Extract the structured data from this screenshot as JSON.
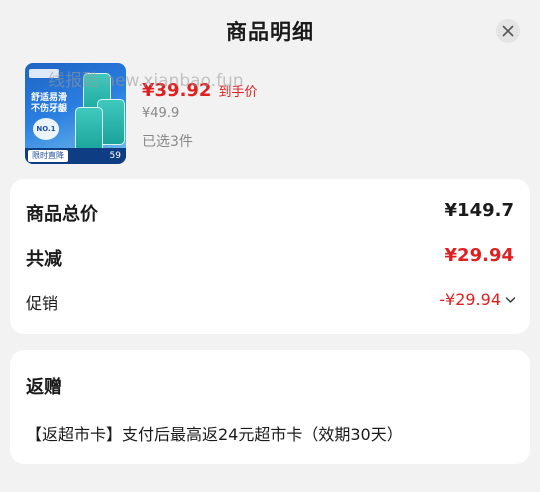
{
  "header": {
    "title": "商品明细",
    "close_icon": "close-icon"
  },
  "product": {
    "thumbnail": {
      "slogan": "舒适易滑\n不伤牙龈",
      "badge": "NO.1",
      "tag": "限时直降",
      "price_text": "59"
    },
    "price": "¥39.92",
    "price_tag": "到手价",
    "original_price": "¥49.9",
    "quantity": "已选3件"
  },
  "watermark": "线报酷 new.xianbao.fun",
  "summary": {
    "total_label": "商品总价",
    "total_value": "¥149.7",
    "discount_label": "共减",
    "discount_value": "¥29.94",
    "promo_label": "促销",
    "promo_value": "-¥29.94",
    "promo_icon": "chevron-down-icon"
  },
  "gift": {
    "title": "返赠",
    "description": "【返超市卡】支付后最高返24元超市卡（效期30天）"
  },
  "colors": {
    "accent": "#e02020",
    "background": "#f2f2f2",
    "card": "#ffffff"
  }
}
